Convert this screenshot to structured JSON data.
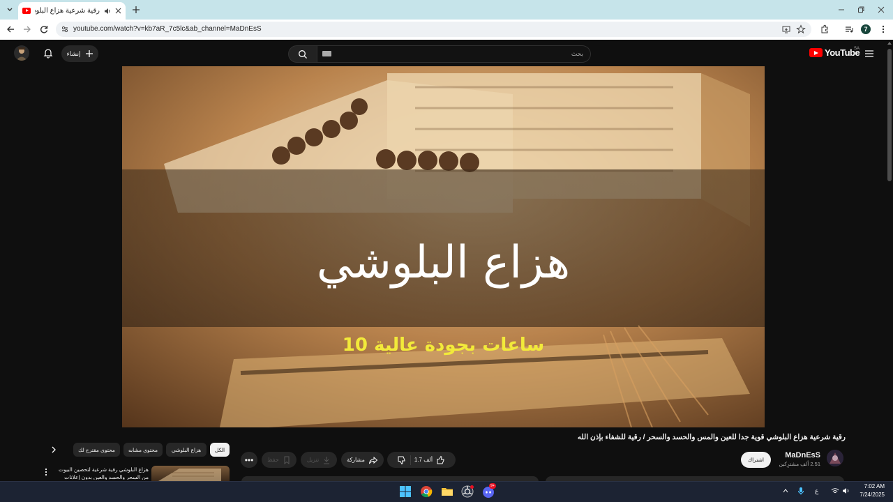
{
  "browser": {
    "tab_title": "رقية شرعية هزاع البلوشي قوية",
    "url": "youtube.com/watch?v=kb7aR_7c5lc&ab_channel=MaDnEsS",
    "profile_initial": "7"
  },
  "youtube": {
    "create_label": "إنشاء",
    "search_placeholder": "بحث",
    "logo_text": "YouTube",
    "country_code": "SA",
    "colors": {
      "brand": "#ff0000",
      "background": "#0f0f0f",
      "chip": "#272727"
    }
  },
  "player": {
    "overlay_title": "هزاع البلوشي",
    "overlay_subtitle": "10 ساعات بجودة عالية"
  },
  "video": {
    "title": "رقية شرعية هزاع البلوشي قوية جدا للعين والمس والحسد والسحر / رقية للشفاء بإذن الله",
    "channel_name": "MaDnEsS",
    "subscribers": "2.51 ألف مشترِكين",
    "subscribe_label": "اشتراك",
    "likes": "1.7 ألف",
    "share_label": "مشاركة",
    "download_label": "تنزيل",
    "save_label": "حفظ",
    "more_label": "•••"
  },
  "chips": {
    "all": "الكل",
    "c1": "هزاع البلوشي",
    "c2": "محتوى مشابه",
    "c3": "محتوى مقترح لك"
  },
  "recommendation": {
    "title": "هزاع البلوشي رقية شرعية لتحصين البيوت من السحر والحسد والعين بدون إعلانات"
  },
  "taskbar": {
    "language": "ع",
    "time": "7:02 AM",
    "date": "7/24/2025",
    "discord_badge": "9+"
  }
}
